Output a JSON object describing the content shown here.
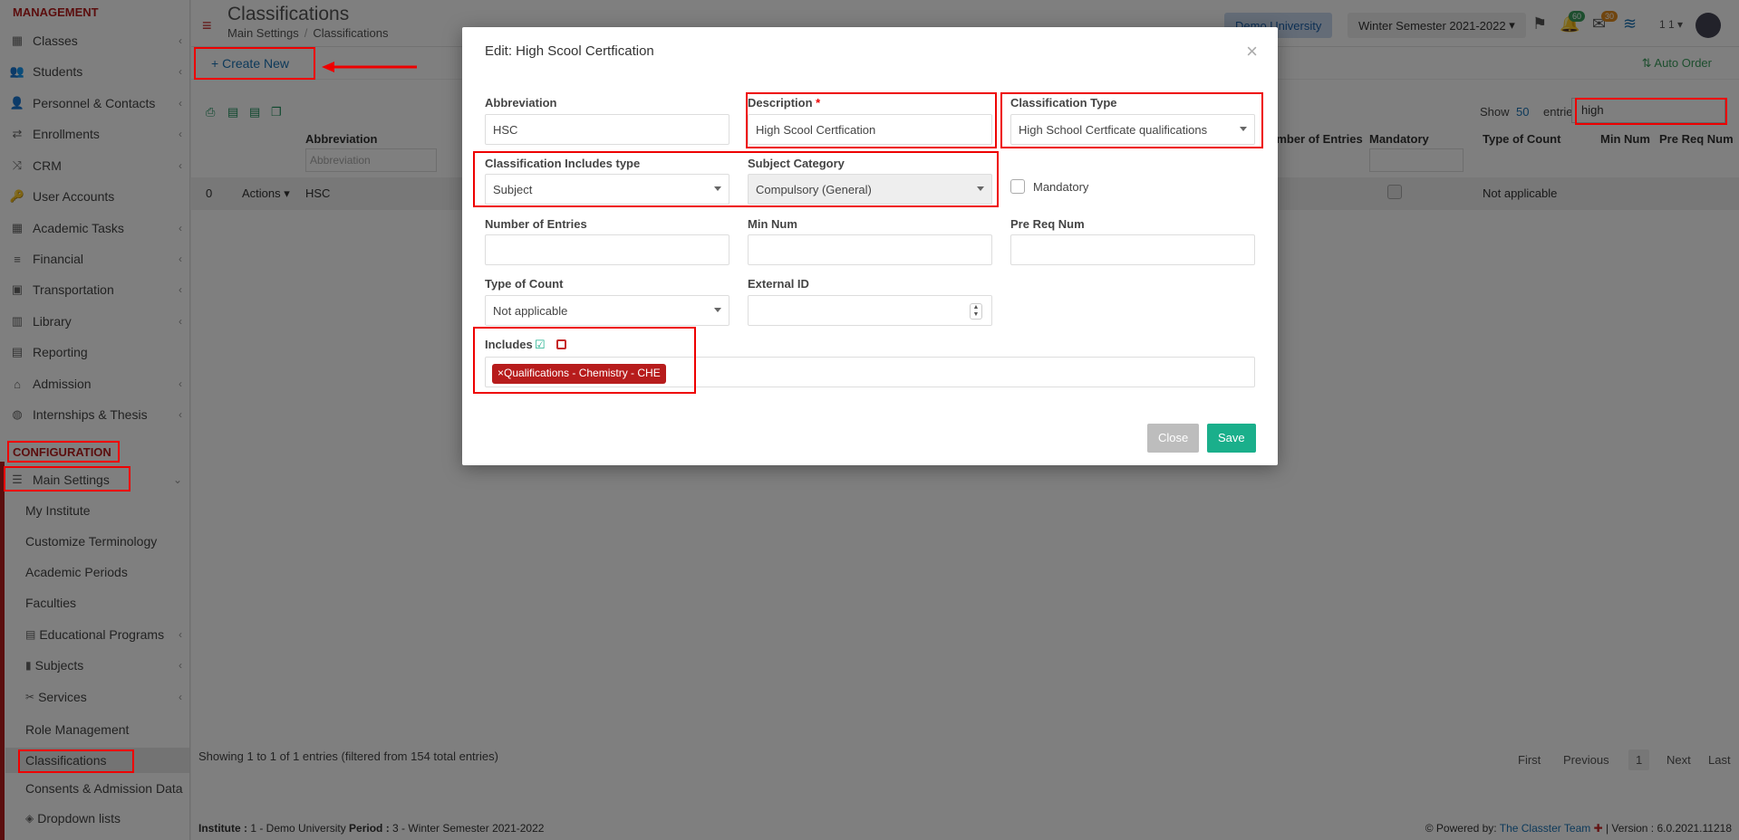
{
  "sidebar": {
    "management_heading": "MANAGEMENT",
    "items": [
      {
        "label": "Classes",
        "icon": "classes-icon",
        "glyph": "▦",
        "chev": true
      },
      {
        "label": "Students",
        "icon": "students-icon",
        "glyph": "👥",
        "chev": true
      },
      {
        "label": "Personnel & Contacts",
        "icon": "personnel-icon",
        "glyph": "👤",
        "chev": true
      },
      {
        "label": "Enrollments",
        "icon": "enrollments-icon",
        "glyph": "⇄",
        "chev": true
      },
      {
        "label": "CRM",
        "icon": "crm-icon",
        "glyph": "⤨",
        "chev": true
      },
      {
        "label": "User Accounts",
        "icon": "key-icon",
        "glyph": "🔑",
        "chev": false
      },
      {
        "label": "Academic Tasks",
        "icon": "grid-icon",
        "glyph": "▦",
        "chev": true
      },
      {
        "label": "Financial",
        "icon": "coins-icon",
        "glyph": "≡",
        "chev": true
      },
      {
        "label": "Transportation",
        "icon": "bus-icon",
        "glyph": "▣",
        "chev": true
      },
      {
        "label": "Library",
        "icon": "library-icon",
        "glyph": "▥",
        "chev": true
      },
      {
        "label": "Reporting",
        "icon": "print-icon",
        "glyph": "▤",
        "chev": false
      },
      {
        "label": "Admission",
        "icon": "bank-icon",
        "glyph": "⌂",
        "chev": true
      },
      {
        "label": "Internships & Thesis",
        "icon": "globe-icon",
        "glyph": "◍",
        "chev": true
      }
    ],
    "config_heading": "CONFIGURATION",
    "main_settings": "Main Settings",
    "sub_items": [
      {
        "label": "My Institute",
        "glyph": "",
        "chev": false
      },
      {
        "label": "Customize Terminology",
        "glyph": "",
        "chev": false
      },
      {
        "label": "Academic Periods",
        "glyph": "",
        "chev": false
      },
      {
        "label": "Faculties",
        "glyph": "",
        "chev": false
      },
      {
        "label": "Educational Programs",
        "glyph": "▤",
        "chev": true
      },
      {
        "label": "Subjects",
        "glyph": "▮",
        "chev": true
      },
      {
        "label": "Services",
        "glyph": "✂",
        "chev": true
      },
      {
        "label": "Role Management",
        "glyph": "",
        "chev": false
      },
      {
        "label": "Classifications",
        "glyph": "",
        "chev": false
      },
      {
        "label": "Consents & Admission Data",
        "glyph": "",
        "chev": false
      },
      {
        "label": "Dropdown lists",
        "glyph": "◈",
        "chev": false
      }
    ]
  },
  "header": {
    "title": "Classifications",
    "breadcrumb": [
      "Main Settings",
      "Classifications"
    ],
    "institute": "Demo University",
    "semester": "Winter Semester 2021-2022",
    "notif_count": "60",
    "mail_count": "30",
    "user_short": "1 1"
  },
  "toolbar": {
    "create_new": "Create New",
    "auto_order": "Auto Order"
  },
  "table": {
    "show_label": "Show",
    "show_value": "50",
    "entries_label": "entries",
    "search_value": "high",
    "headers": {
      "abbreviation": "Abbreviation",
      "num_entries": "Number of Entries",
      "mandatory": "Mandatory",
      "type_of_count": "Type of Count",
      "min_num": "Min Num",
      "pre_req": "Pre Req Num"
    },
    "filter_placeholder": "Abbreviation",
    "row": {
      "index": "0",
      "actions": "Actions",
      "abbreviation": "HSC",
      "type_of_count": "Not applicable"
    },
    "info": "Showing 1 to 1 of 1 entries (filtered from 154 total entries)",
    "pager": {
      "first": "First",
      "previous": "Previous",
      "current": "1",
      "next": "Next",
      "last": "Last"
    }
  },
  "footer": {
    "institute_label": "Institute :",
    "institute_value": " 1 - Demo University ",
    "period_label": "Period :",
    "period_value": " 3 - Winter Semester 2021-2022",
    "powered": "Powered by:",
    "team": "The Classter Team",
    "version": "| Version : 6.0.2021.11218"
  },
  "modal": {
    "title": "Edit: High Scool Certfication",
    "fields": {
      "abbreviation": {
        "label": "Abbreviation",
        "value": "HSC"
      },
      "description": {
        "label": "Description",
        "required": "*",
        "value": "High Scool Certfication"
      },
      "classification_type": {
        "label": "Classification Type",
        "value": "High School Certficate qualifications"
      },
      "includes_type": {
        "label": "Classification Includes type",
        "value": "Subject"
      },
      "subject_category": {
        "label": "Subject Category",
        "value": "Compulsory (General)"
      },
      "mandatory": {
        "label": "Mandatory"
      },
      "num_entries": {
        "label": "Number of Entries",
        "value": ""
      },
      "min_num": {
        "label": "Min Num",
        "value": ""
      },
      "pre_req": {
        "label": "Pre Req Num",
        "value": ""
      },
      "type_of_count": {
        "label": "Type of Count",
        "value": "Not applicable"
      },
      "external_id": {
        "label": "External ID",
        "value": ""
      },
      "includes": {
        "label": "Includes",
        "tag": "Qualifications - Chemistry - CHE"
      }
    },
    "close_label": "Close",
    "save_label": "Save"
  },
  "colors": {
    "accent": "#b71c1c",
    "save": "#1aaf8b",
    "close": "#bdbdbd",
    "highlight": "#ff0000"
  }
}
